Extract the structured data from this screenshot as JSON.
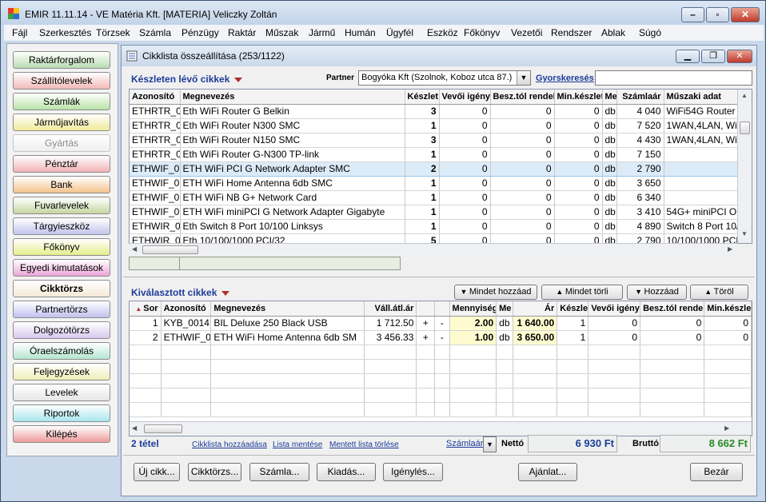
{
  "window": {
    "title": "EMIR 11.11.14 - VE Matéria Kft. [MATERIA] Veliczky Zoltán"
  },
  "menu": [
    "Fájl",
    "Szerkesztés",
    "Törzsek",
    "Számla",
    "Pénzügy",
    "Raktár",
    "Műszak",
    "Jármű",
    "Humán",
    "Ügyfél",
    "Eszköz",
    "Főkönyv",
    "Vezetői",
    "Rendszer",
    "Ablak",
    "Súgó"
  ],
  "nav": [
    {
      "label": "Raktárforgalom",
      "color": "#b9dcb1"
    },
    {
      "label": "Szállítólevelek",
      "color": "#f2b8b8"
    },
    {
      "label": "Számlák",
      "color": "#b9e3a8"
    },
    {
      "label": "Járműjavítás",
      "color": "#f0ea9c"
    },
    {
      "label": "Gyártás",
      "color": "#efefef",
      "disabled": true
    },
    {
      "label": "Pénztár",
      "color": "#f2b2b6"
    },
    {
      "label": "Bank",
      "color": "#f4c28c"
    },
    {
      "label": "Fuvarlevelek",
      "color": "#c5d6a0"
    },
    {
      "label": "Tárgyieszköz",
      "color": "#c2c4ec"
    },
    {
      "label": "Főkönyv",
      "color": "#e4ee8c"
    },
    {
      "label": "Egyedi kimutatások",
      "color": "#eaa6d8"
    },
    {
      "label": "Cikktörzs",
      "color": "#f5e9d6",
      "bold": true
    },
    {
      "label": "Partnertörzs",
      "color": "#c2c0ee"
    },
    {
      "label": "Dolgozótörzs",
      "color": "#d7c8ee"
    },
    {
      "label": "Óraelszámolás",
      "color": "#b5e5d2"
    },
    {
      "label": "Feljegyzések",
      "color": "#eeeeb8"
    },
    {
      "label": "Levelek",
      "color": "#e6e6e6"
    },
    {
      "label": "Riportok",
      "color": "#a8e6ee"
    },
    {
      "label": "Kilépés",
      "color": "#ee9a9a"
    }
  ],
  "inner": {
    "title": "Cikklista összeállítása (253/1122)"
  },
  "stock": {
    "label": "Készleten lévő cikkek",
    "partner_label": "Partner",
    "partner_value": "Bogyóka Kft (Szolnok, Koboz utca 87.)",
    "quick_search": "Gyorskeresés",
    "columns": [
      "Azonosító",
      "Megnevezés",
      "Készlet",
      "Vevői igény",
      "Besz.tól rendelt",
      "Min.készlet",
      "Me",
      "Számlaár",
      "Műszaki adat"
    ],
    "rows": [
      [
        "ETHRTR_0",
        "Eth WiFi Router G Belkin",
        "3",
        "0",
        "0",
        "0",
        "db",
        "4 040",
        "WiFi54G Router"
      ],
      [
        "ETHRTR_0",
        "Eth WiFi Router N300 SMC",
        "1",
        "0",
        "0",
        "0",
        "db",
        "7 520",
        "1WAN,4LAN, WiF"
      ],
      [
        "ETHRTR_0",
        "Eth WiFi Router N150 SMC",
        "3",
        "0",
        "0",
        "0",
        "db",
        "4 430",
        "1WAN,4LAN, WiF"
      ],
      [
        "ETHRTR_0",
        "Eth WiFi Router G-N300 TP-link",
        "1",
        "0",
        "0",
        "0",
        "db",
        "7 150",
        ""
      ],
      [
        "ETHWIF_0",
        "ETH WiFi PCI G Network Adapter SMC",
        "2",
        "0",
        "0",
        "0",
        "db",
        "2 790",
        ""
      ],
      [
        "ETHWIF_0",
        "ETH WiFi Home Antenna 6db SMC",
        "1",
        "0",
        "0",
        "0",
        "db",
        "3 650",
        ""
      ],
      [
        "ETHWIF_0",
        "ETH WiFi NB G+ Network Card",
        "1",
        "0",
        "0",
        "0",
        "db",
        "6 340",
        ""
      ],
      [
        "ETHWIF_0",
        "ETH WiFi miniPCI G Network Adapter Gigabyte",
        "1",
        "0",
        "0",
        "0",
        "db",
        "3 410",
        "54G+ miniPCI OI"
      ],
      [
        "ETHWIR_0",
        "Eth Switch 8 Port 10/100 Linksys",
        "1",
        "0",
        "0",
        "0",
        "db",
        "4 890",
        "Switch 8 Port 10/"
      ],
      [
        "ETHWIR_0",
        "Eth 10/100/1000 PCI/32",
        "5",
        "0",
        "0",
        "0",
        "db",
        "2 790",
        "10/100/1000 PCI/"
      ]
    ]
  },
  "selected": {
    "label": "Kiválasztott cikkek",
    "buttons": [
      "Mindet hozzáad",
      "Mindet törli",
      "Hozzáad",
      "Töröl"
    ],
    "columns": [
      "Sor",
      "Azonosító",
      "Megnevezés",
      "Váll.átl.ár",
      "",
      "",
      "Mennyiség",
      "Me",
      "Ár",
      "Készlet",
      "Vevői igény",
      "Besz.tól rendelt",
      "Min.készlet"
    ],
    "rows": [
      [
        "1",
        "KYB_0014",
        "BIL Deluxe 250 Black USB",
        "1 712.50",
        "+",
        "-",
        "2.00",
        "db",
        "1 640.00",
        "1",
        "0",
        "0",
        "0"
      ],
      [
        "2",
        "ETHWIF_0",
        "ETH WiFi Home Antenna 6db SM",
        "3 456.33",
        "+",
        "-",
        "1.00",
        "db",
        "3 650.00",
        "1",
        "0",
        "0",
        "0"
      ]
    ]
  },
  "summary": {
    "count": "2 tétel",
    "links": [
      "Cikklista hozzáadása",
      "Lista mentése",
      "Mentett lista törlése"
    ],
    "price_link": "Számlaár",
    "netto_label": "Nettó",
    "netto_value": "6 930 Ft",
    "brutto_label": "Bruttó",
    "brutto_value": "8 662 Ft"
  },
  "footer_buttons": [
    "Új cikk...",
    "Cikktörzs...",
    "Számla...",
    "Kiadás...",
    "Igénylés...",
    "Ajánlat...",
    "Bezár"
  ]
}
